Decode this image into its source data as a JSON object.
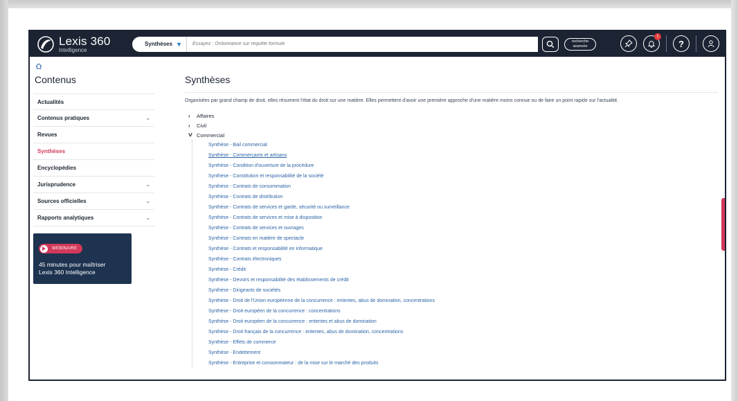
{
  "header": {
    "logo_name": "Lexis 360",
    "logo_sub": "Intelligence",
    "search_scope": "Synthèses",
    "search_placeholder": "Essayez : Ordonnance sur requête formule",
    "advanced_line1": "recherche",
    "advanced_line2": "avancée",
    "notification_count": "1",
    "icons": [
      "search-icon",
      "pin-icon",
      "bell-icon",
      "help-icon",
      "user-icon"
    ]
  },
  "sidebar": {
    "title": "Contenus",
    "items": [
      {
        "label": "Actualités",
        "chevron": false,
        "active": false
      },
      {
        "label": "Contenus pratiques",
        "chevron": true,
        "active": false
      },
      {
        "label": "Revues",
        "chevron": false,
        "active": false
      },
      {
        "label": "Synthèses",
        "chevron": false,
        "active": true
      },
      {
        "label": "Encyclopédies",
        "chevron": false,
        "active": false
      },
      {
        "label": "Jurisprudence",
        "chevron": true,
        "active": false
      },
      {
        "label": "Sources officielles",
        "chevron": true,
        "active": false
      },
      {
        "label": "Rapports analytiques",
        "chevron": true,
        "active": false
      }
    ],
    "promo": {
      "badge": "WEBINAIRE",
      "text_line1": "45 minutes pour maîtriser",
      "text_line2": "Lexis 360 Intelligence"
    }
  },
  "main": {
    "title": "Synthèses",
    "intro": "Organisées par grand champ de droit, elles résument l'état du droit sur une matière. Elles permettent d'avoir une première approche d'une matière moins connue ou de faire un point rapide sur l'actualité.",
    "categories": [
      {
        "label": "Affaires",
        "expanded": false
      },
      {
        "label": "Civil",
        "expanded": false
      },
      {
        "label": "Commercial",
        "expanded": true
      }
    ],
    "commercial_items": [
      "Synthèse - Bail commercial",
      "Synthèse - Commerçants et artisans",
      "Synthèse - Condition d'ouverture de la procédure",
      "Synthèse - Constitution et responsabilité de la société",
      "Synthèse - Contrats de consommation",
      "Synthèse - Contrats de distribution",
      "Synthèse - Contrats de services et garde, sécurité ou surveillance",
      "Synthèse - Contrats de services et mise à disposition",
      "Synthèse - Contrats de services et ouvrages",
      "Synthèse - Contrats en matière de spectacle",
      "Synthèse - Contrats et responsabilité en informatique",
      "Synthèse - Contrats électroniques",
      "Synthèse - Crédit",
      "Synthèse - Devoirs et responsabilité des établissements de crédit",
      "Synthèse - Dirigeants de sociétés",
      "Synthèse - Droit de l'Union européenne de la concurrence : ententes, abus de domination, concentrations",
      "Synthèse - Droit européen de la concurrence : concentrations",
      "Synthèse - Droit européen de la concurrence : ententes et abus de domination",
      "Synthèse - Droit français de la concurrence : ententes, abus de domination, concentrations",
      "Synthèse - Effets de commerce",
      "Synthèse - Endettement",
      "Synthèse - Entreprise et consommateur : de la mise sur le marché des produits"
    ],
    "hovered_index": 1
  },
  "colors": {
    "navy": "#1c2433",
    "accent": "#d2395a",
    "link": "#2b63a6",
    "promo_bg": "#1d3350"
  }
}
